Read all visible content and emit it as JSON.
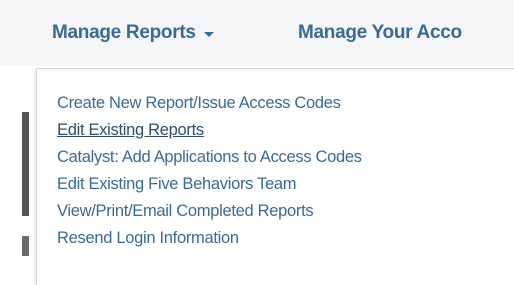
{
  "navbar": {
    "manage_reports_label": "Manage Reports",
    "manage_account_label": "Manage Your Acco"
  },
  "dropdown": {
    "items": [
      {
        "label": "Create New Report/Issue Access Codes"
      },
      {
        "label": "Edit Existing Reports",
        "hovered": true
      },
      {
        "label": "Catalyst: Add Applications to Access Codes"
      },
      {
        "label": "Edit Existing Five Behaviors Team"
      },
      {
        "label": "View/Print/Email Completed Reports"
      },
      {
        "label": "Resend Login Information"
      }
    ]
  },
  "colors": {
    "link": "#3a6a96",
    "link_hover": "#2d4d6d",
    "navbar_bg": "#f4f6f8"
  },
  "icons": {
    "dropdown_caret": "caret-down-icon"
  }
}
